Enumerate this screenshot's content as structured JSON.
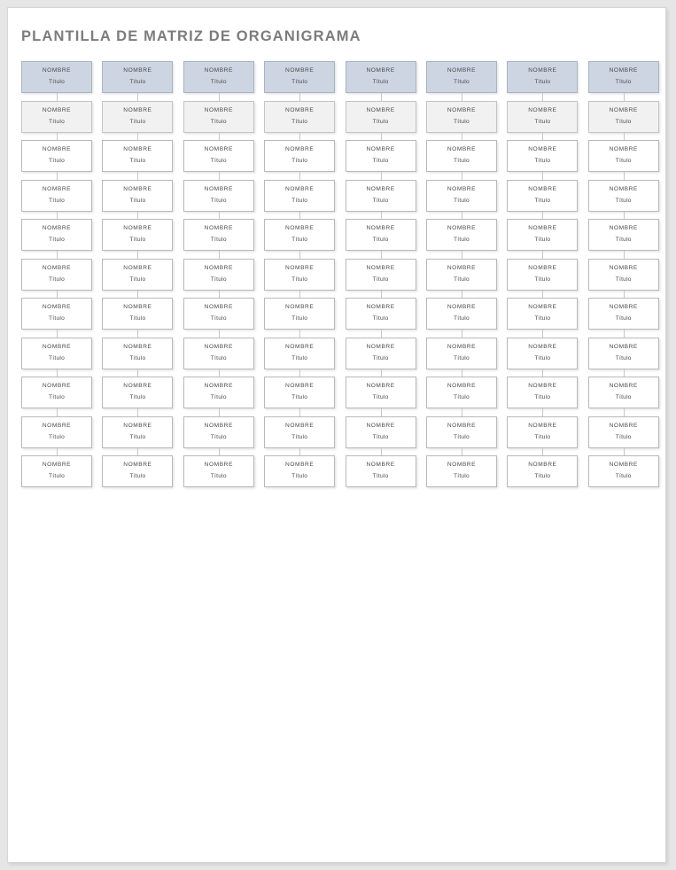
{
  "page": {
    "title": "PLANTILLA DE MATRIZ DE ORGANIGRAMA",
    "background_color": "#e6e6e6",
    "paper_color": "#ffffff",
    "title_color": "#7c7c7c"
  },
  "matrix": {
    "columns": 8,
    "rows": 11,
    "node_label_name": "NOMBRE",
    "node_label_title": "Título",
    "row_styles": [
      "head",
      "sub",
      "plain",
      "plain",
      "plain",
      "plain",
      "plain",
      "plain",
      "plain",
      "plain",
      "plain"
    ],
    "colors": {
      "head_fill": "#ccd5e1",
      "head_border": "#a9b3c1",
      "sub_fill": "#f1f1f1",
      "sub_border": "#c4c4c4",
      "plain_fill": "#ffffff",
      "plain_border": "#b9b9b9",
      "connector": "#c7c7c7",
      "node_text": "#4a4a4a"
    }
  }
}
